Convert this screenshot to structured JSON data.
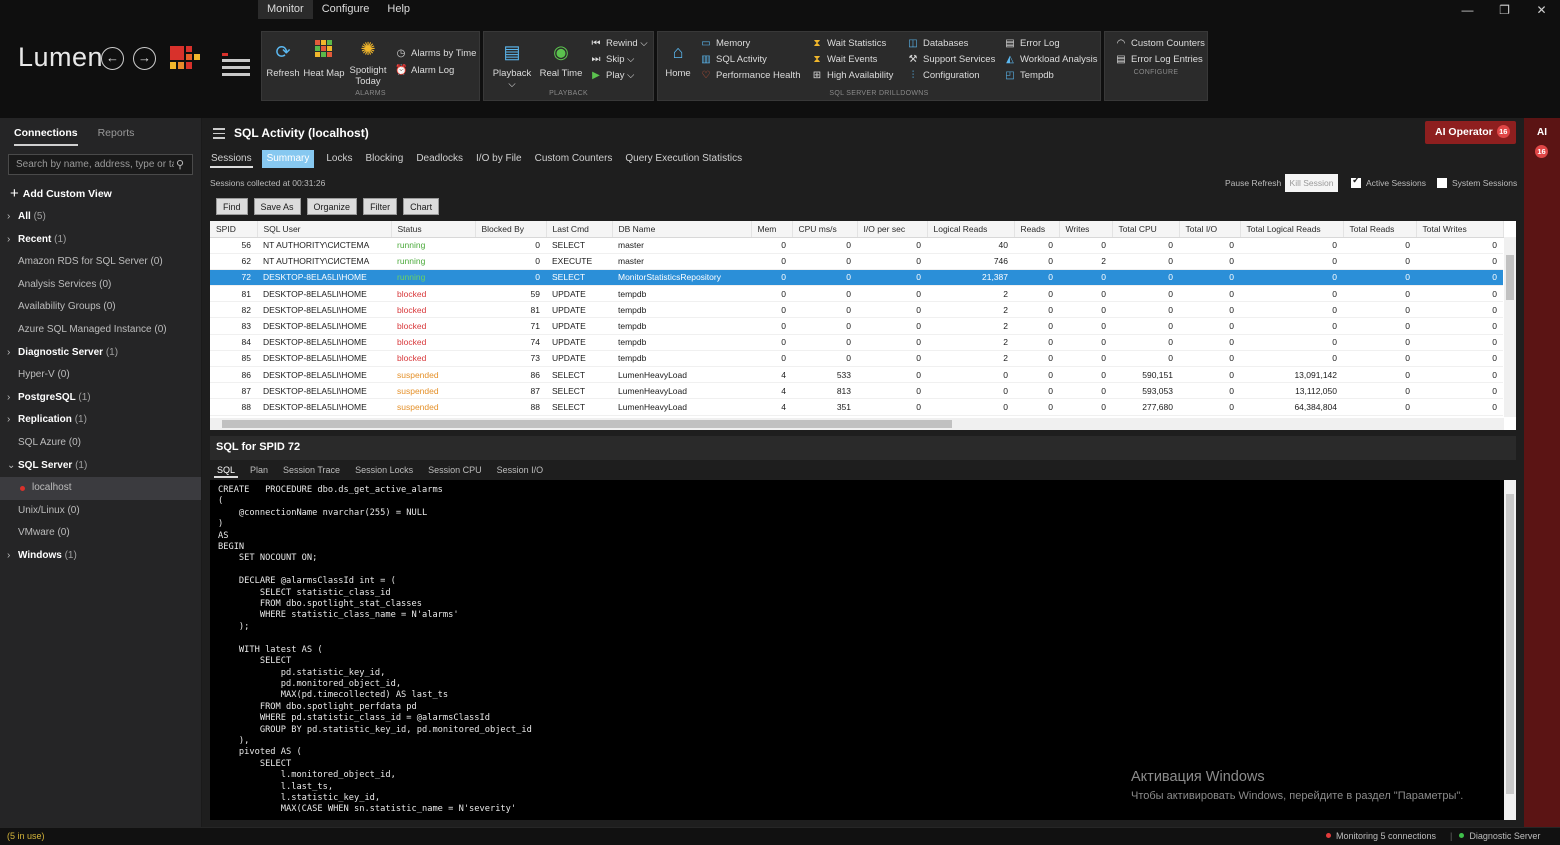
{
  "app": {
    "logo": "Lumen",
    "menu": [
      "Monitor",
      "Configure",
      "Help"
    ],
    "active_menu": "Monitor",
    "window_controls": [
      "—",
      "❐",
      "✕"
    ]
  },
  "ribbon": {
    "alarms": {
      "label": "ALARMS",
      "refresh": "Refresh",
      "heat_map": "Heat Map",
      "spotlight_1": "Spotlight",
      "spotlight_2": "Today",
      "alarms_by_time": "Alarms by Time",
      "alarm_log": "Alarm Log"
    },
    "playback": {
      "label": "PLAYBACK",
      "playback": "Playback ⌵",
      "real_time": "Real Time",
      "rewind": "Rewind ⌵",
      "skip": "Skip ⌵",
      "play": "Play ⌵"
    },
    "drilldowns": {
      "label": "SQL SERVER DRILLDOWNS",
      "home": "Home",
      "memory": "Memory",
      "sql_activity": "SQL Activity",
      "performance_health": "Performance Health",
      "wait_statistics": "Wait Statistics",
      "wait_events": "Wait Events",
      "high_availability": "High Availability",
      "databases": "Databases",
      "support_services": "Support Services",
      "configuration": "Configuration",
      "error_log": "Error Log",
      "workload_analysis": "Workload Analysis",
      "tempdb": "Tempdb"
    },
    "configure": {
      "label": "CONFIGURE",
      "custom_counters": "Custom Counters",
      "error_log_entries": "Error Log Entries"
    }
  },
  "sidebar": {
    "tabs": [
      "Connections",
      "Reports"
    ],
    "search_placeholder": "Search by name, address, type or tag",
    "add_custom_view": "Add Custom View",
    "items": [
      {
        "label": "All",
        "count": "(5)",
        "group": true
      },
      {
        "label": "Recent",
        "count": "(1)",
        "group": true
      },
      {
        "label": "Amazon RDS for SQL Server (0)",
        "count": "",
        "group": false
      },
      {
        "label": "Analysis Services (0)",
        "count": "",
        "group": false
      },
      {
        "label": "Availability Groups (0)",
        "count": "",
        "group": false
      },
      {
        "label": "Azure SQL Managed Instance (0)",
        "count": "",
        "group": false
      },
      {
        "label": "Diagnostic Server",
        "count": "(1)",
        "group": true
      },
      {
        "label": "Hyper-V (0)",
        "count": "",
        "group": false
      },
      {
        "label": "PostgreSQL",
        "count": "(1)",
        "group": true
      },
      {
        "label": "Replication",
        "count": "(1)",
        "group": true
      },
      {
        "label": "SQL Azure (0)",
        "count": "",
        "group": false
      },
      {
        "label": "SQL Server",
        "count": "(1)",
        "group": true,
        "expanded": true
      },
      {
        "label": "localhost",
        "count": "",
        "group": false,
        "selected": true
      },
      {
        "label": "Unix/Linux (0)",
        "count": "",
        "group": false
      },
      {
        "label": "VMware (0)",
        "count": "",
        "group": false
      },
      {
        "label": "Windows",
        "count": "(1)",
        "group": true
      }
    ]
  },
  "main": {
    "title": "SQL Activity (localhost)",
    "ai_operator": "AI Operator",
    "ai_badge": "16",
    "tabs": [
      "Sessions",
      "Summary",
      "Locks",
      "Blocking",
      "Deadlocks",
      "I/O by File",
      "Custom Counters",
      "Query Execution Statistics"
    ],
    "collected": "Sessions collected at 00:31:26",
    "pause_refresh": "Pause Refresh",
    "kill_session": "Kill Session",
    "active_sessions": "Active Sessions",
    "system_sessions": "System Sessions",
    "actions": [
      "Find",
      "Save As",
      "Organize",
      "Filter",
      "Chart"
    ]
  },
  "grid": {
    "columns": [
      "SPID",
      "SQL User",
      "Status",
      "Blocked By",
      "Last Cmd",
      "DB Name",
      "Mem",
      "CPU ms/s",
      "I/O per sec",
      "Logical Reads",
      "Reads",
      "Writes",
      "Total CPU",
      "Total I/O",
      "Total Logical Reads",
      "Total Reads",
      "Total Writes"
    ],
    "selected_row": 2,
    "rows": [
      [
        "56",
        "NT AUTHORITY\\СИСТЕМА",
        "running",
        "0",
        "SELECT",
        "master",
        "0",
        "0",
        "0",
        "40",
        "0",
        "0",
        "0",
        "0",
        "0",
        "0",
        "0"
      ],
      [
        "62",
        "NT AUTHORITY\\СИСТЕМА",
        "running",
        "0",
        "EXECUTE",
        "master",
        "0",
        "0",
        "0",
        "746",
        "0",
        "2",
        "0",
        "0",
        "0",
        "0",
        "0"
      ],
      [
        "72",
        "DESKTOP-8ELA5LI\\HOME",
        "running",
        "0",
        "SELECT",
        "MonitorStatisticsRepository",
        "0",
        "0",
        "0",
        "21,387",
        "0",
        "0",
        "0",
        "0",
        "0",
        "0",
        "0"
      ],
      [
        "81",
        "DESKTOP-8ELA5LI\\HOME",
        "blocked",
        "59",
        "UPDATE",
        "tempdb",
        "0",
        "0",
        "0",
        "2",
        "0",
        "0",
        "0",
        "0",
        "0",
        "0",
        "0"
      ],
      [
        "82",
        "DESKTOP-8ELA5LI\\HOME",
        "blocked",
        "81",
        "UPDATE",
        "tempdb",
        "0",
        "0",
        "0",
        "2",
        "0",
        "0",
        "0",
        "0",
        "0",
        "0",
        "0"
      ],
      [
        "83",
        "DESKTOP-8ELA5LI\\HOME",
        "blocked",
        "71",
        "UPDATE",
        "tempdb",
        "0",
        "0",
        "0",
        "2",
        "0",
        "0",
        "0",
        "0",
        "0",
        "0",
        "0"
      ],
      [
        "84",
        "DESKTOP-8ELA5LI\\HOME",
        "blocked",
        "74",
        "UPDATE",
        "tempdb",
        "0",
        "0",
        "0",
        "2",
        "0",
        "0",
        "0",
        "0",
        "0",
        "0",
        "0"
      ],
      [
        "85",
        "DESKTOP-8ELA5LI\\HOME",
        "blocked",
        "73",
        "UPDATE",
        "tempdb",
        "0",
        "0",
        "0",
        "2",
        "0",
        "0",
        "0",
        "0",
        "0",
        "0",
        "0"
      ],
      [
        "86",
        "DESKTOP-8ELA5LI\\HOME",
        "suspended",
        "86",
        "SELECT",
        "LumenHeavyLoad",
        "4",
        "533",
        "0",
        "0",
        "0",
        "0",
        "590,151",
        "0",
        "13,091,142",
        "0",
        "0"
      ],
      [
        "87",
        "DESKTOP-8ELA5LI\\HOME",
        "suspended",
        "87",
        "SELECT",
        "LumenHeavyLoad",
        "4",
        "813",
        "0",
        "0",
        "0",
        "0",
        "593,053",
        "0",
        "13,112,050",
        "0",
        "0"
      ],
      [
        "88",
        "DESKTOP-8ELA5LI\\HOME",
        "suspended",
        "88",
        "SELECT",
        "LumenHeavyLoad",
        "4",
        "351",
        "0",
        "0",
        "0",
        "0",
        "277,680",
        "0",
        "64,384,804",
        "0",
        "0"
      ]
    ]
  },
  "sql_panel": {
    "title": "SQL for SPID 72",
    "tabs": [
      "SQL",
      "Plan",
      "Session Trace",
      "Session Locks",
      "Session CPU",
      "Session I/O"
    ],
    "code": "CREATE   PROCEDURE dbo.ds_get_active_alarms\n(\n    @connectionName nvarchar(255) = NULL\n)\nAS\nBEGIN\n    SET NOCOUNT ON;\n\n    DECLARE @alarmsClassId int = (\n        SELECT statistic_class_id\n        FROM dbo.spotlight_stat_classes\n        WHERE statistic_class_name = N'alarms'\n    );\n\n    WITH latest AS (\n        SELECT\n            pd.statistic_key_id,\n            pd.monitored_object_id,\n            MAX(pd.timecollected) AS last_ts\n        FROM dbo.spotlight_perfdata pd\n        WHERE pd.statistic_class_id = @alarmsClassId\n        GROUP BY pd.statistic_key_id, pd.monitored_object_id\n    ),\n    pivoted AS (\n        SELECT\n            l.monitored_object_id,\n            l.last_ts,\n            l.statistic_key_id,\n            MAX(CASE WHEN sn.statistic_name = N'severity'"
  },
  "watermark": {
    "line1": "Активация Windows",
    "line2": "Чтобы активировать Windows, перейдите в раздел \"Параметры\"."
  },
  "ai_strip": {
    "label": "AI",
    "badge": "16"
  },
  "status": {
    "in_use": "(5 in use)",
    "monitoring": "Monitoring 5 connections",
    "diagnostic": "Diagnostic Server",
    "monitoring_color": "#e23b3b",
    "diagnostic_color": "#3fbf4a"
  }
}
